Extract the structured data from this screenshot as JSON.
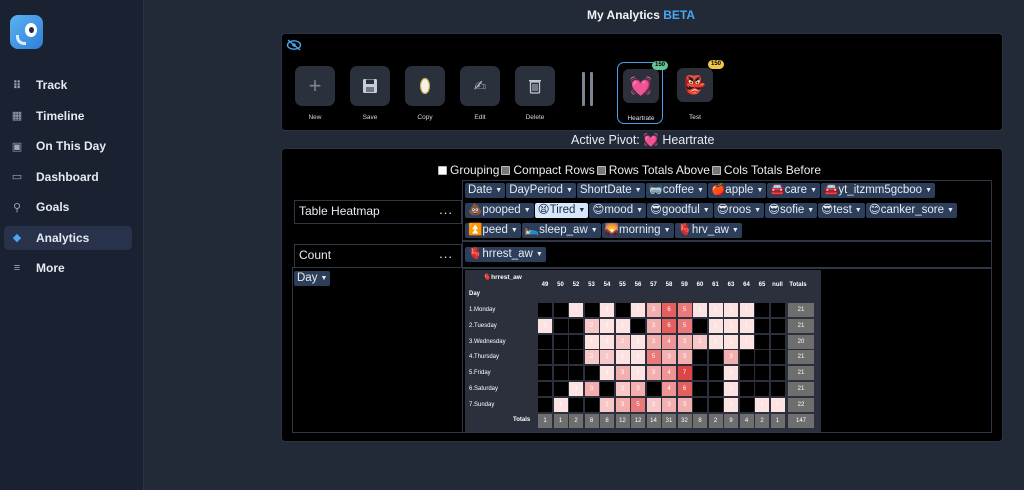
{
  "app": {
    "title": "My Analytics",
    "beta": "BETA"
  },
  "sidebar": {
    "items": [
      {
        "label": "Track",
        "icon": "grid-icon"
      },
      {
        "label": "Timeline",
        "icon": "calendar-icon"
      },
      {
        "label": "On This Day",
        "icon": "calendar-31-icon"
      },
      {
        "label": "Dashboard",
        "icon": "monitor-icon"
      },
      {
        "label": "Goals",
        "icon": "rocket-icon"
      },
      {
        "label": "Analytics",
        "icon": "cube-icon"
      },
      {
        "label": "More",
        "icon": "menu-icon"
      }
    ],
    "active": "Analytics"
  },
  "toolbar": {
    "buttons": [
      {
        "label": "New",
        "icon": "plus-icon"
      },
      {
        "label": "Save",
        "icon": "floppy-icon"
      },
      {
        "label": "Copy",
        "icon": "copy-icon"
      },
      {
        "label": "Edit",
        "icon": "edit-hand-icon"
      },
      {
        "label": "Delete",
        "icon": "trash-icon"
      }
    ],
    "pivots": [
      {
        "label": "Heartrate",
        "emoji": "💓",
        "badge": "150",
        "active": true
      },
      {
        "label": "Test",
        "emoji": "👺",
        "badge": "150",
        "active": false
      }
    ]
  },
  "active_pivot": {
    "prefix": "Active Pivot:",
    "emoji": "💓",
    "name": "Heartrate"
  },
  "options": [
    {
      "label": "Grouping",
      "checked": false
    },
    {
      "label": "Compact Rows",
      "checked": true
    },
    {
      "label": "Rows Totals Above",
      "checked": true
    },
    {
      "label": "Cols Totals Before",
      "checked": true
    }
  ],
  "renderer": {
    "value": "Table Heatmap",
    "menu": "..."
  },
  "aggregator": {
    "value": "Count",
    "menu": "..."
  },
  "unused_fields": [
    "Date",
    "DayPeriod",
    "ShortDate",
    "🥽coffee",
    "🍎apple",
    "🚘care",
    "🚘yt_itzmm5gcboo",
    "💩pooped",
    "😫Tired",
    "😊mood",
    "😎goodful",
    "😎roos",
    "😎sofie",
    "😎test",
    "😊canker_sore",
    "⏫peed",
    "🛌sleep_aw",
    "🌄morning",
    "🫀hrv_aw"
  ],
  "highlighted_field": "😫Tired",
  "col_field": "🫀hrrest_aw",
  "row_field": "Day",
  "table": {
    "title": "🫀hrrest_aw",
    "row_header": "Day",
    "columns": [
      "49",
      "50",
      "52",
      "53",
      "54",
      "55",
      "56",
      "57",
      "58",
      "59",
      "60",
      "61",
      "63",
      "64",
      "65",
      "null"
    ],
    "totals_label": "Totals",
    "rows": [
      {
        "label": "1.Monday",
        "cells": [
          null,
          null,
          "1",
          null,
          "1",
          null,
          "1",
          "3",
          "6",
          "5",
          "1",
          "1",
          "1",
          "1",
          null,
          null
        ],
        "total": "21"
      },
      {
        "label": "2.Tuesday",
        "cells": [
          "1",
          null,
          null,
          "2",
          "1",
          "1",
          null,
          "3",
          "6",
          "5",
          null,
          "1",
          "1",
          "1",
          null,
          null
        ],
        "total": "21"
      },
      {
        "label": "3.Wednesday",
        "cells": [
          null,
          null,
          null,
          "1",
          "1",
          "2",
          "1",
          "3",
          "4",
          "3",
          "2",
          "1",
          "1",
          "1",
          null,
          null
        ],
        "total": "20"
      },
      {
        "label": "4.Thursday",
        "cells": [
          null,
          null,
          null,
          "2",
          "2",
          "1",
          "1",
          "5",
          "3",
          "3",
          null,
          null,
          "3",
          null,
          null,
          null
        ],
        "total": "21"
      },
      {
        "label": "5.Friday",
        "cells": [
          null,
          null,
          null,
          null,
          "1",
          "3",
          "1",
          "3",
          "4",
          "7",
          null,
          null,
          "1",
          null,
          null,
          null
        ],
        "total": "21"
      },
      {
        "label": "6.Saturday",
        "cells": [
          null,
          null,
          "1",
          "3",
          null,
          "2",
          "3",
          null,
          "4",
          "6",
          null,
          null,
          "1",
          null,
          null,
          null
        ],
        "total": "21"
      },
      {
        "label": "7.Sunday",
        "cells": [
          null,
          "1",
          null,
          null,
          "2",
          "3",
          "5",
          "2",
          "3",
          "3",
          null,
          null,
          "1",
          null,
          "1",
          "1"
        ],
        "total": "22"
      }
    ],
    "col_totals": [
      "1",
      "1",
      "2",
      "8",
      "8",
      "12",
      "12",
      "14",
      "31",
      "32",
      "8",
      "2",
      "9",
      "4",
      "2",
      "1"
    ],
    "grand_total": "147"
  },
  "colors": {
    "accent": "#4aa6f0",
    "heat_low": "#fde2e2",
    "heat_high": "#e04545",
    "chip_bg": "#2c3e5a"
  }
}
